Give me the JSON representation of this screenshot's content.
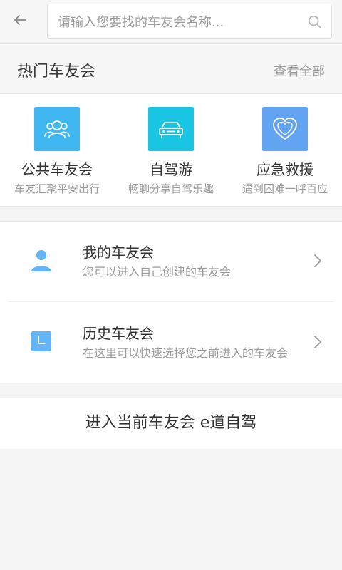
{
  "search": {
    "placeholder": "请输入您要找的车友会名称..."
  },
  "hot": {
    "title": "热门车友会",
    "view_all": "查看全部",
    "items": [
      {
        "name": "公共车友会",
        "subtitle": "车友汇聚平安出行",
        "icon": "people-icon",
        "color": "#41b7f2"
      },
      {
        "name": "自驾游",
        "subtitle": "畅聊分享自驾乐趣",
        "icon": "car-icon",
        "color": "#19c5e3"
      },
      {
        "name": "应急救援",
        "subtitle": "遇到困难一呼百应",
        "icon": "heart-icon",
        "color": "#62a3f2"
      }
    ]
  },
  "list": {
    "items": [
      {
        "title": "我的车友会",
        "subtitle": "您可以进入自己创建的车友会",
        "icon": "user-icon",
        "color": "#64b5f6"
      },
      {
        "title": "历史车友会",
        "subtitle": "在这里可以快速选择您之前进入的车友会",
        "icon": "clock-icon",
        "color": "#64b5f6"
      }
    ]
  },
  "enter_current": {
    "label": "进入当前车友会 e道自驾"
  },
  "colors": {
    "background": "#f5f5f5",
    "text_primary": "#333333",
    "text_secondary": "#9a9a9a"
  }
}
